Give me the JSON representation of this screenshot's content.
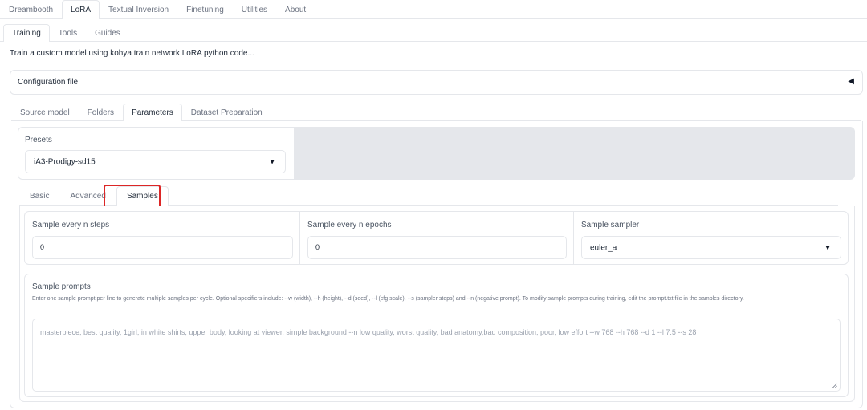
{
  "top_tabs": {
    "items": [
      {
        "label": "Dreambooth",
        "active": false
      },
      {
        "label": "LoRA",
        "active": true
      },
      {
        "label": "Textual Inversion",
        "active": false
      },
      {
        "label": "Finetuning",
        "active": false
      },
      {
        "label": "Utilities",
        "active": false
      },
      {
        "label": "About",
        "active": false
      }
    ]
  },
  "sub_tabs": {
    "items": [
      {
        "label": "Training",
        "active": true
      },
      {
        "label": "Tools",
        "active": false
      },
      {
        "label": "Guides",
        "active": false
      }
    ]
  },
  "description": "Train a custom model using kohya train network LoRA python code...",
  "config_accordion": {
    "label": "Configuration file",
    "arrow": "◀"
  },
  "param_tabs": {
    "items": [
      {
        "label": "Source model",
        "active": false
      },
      {
        "label": "Folders",
        "active": false
      },
      {
        "label": "Parameters",
        "active": true
      },
      {
        "label": "Dataset Preparation",
        "active": false
      }
    ]
  },
  "presets": {
    "label": "Presets",
    "value": "iA3-Prodigy-sd15",
    "caret": "▼"
  },
  "inner_tabs": {
    "items": [
      {
        "label": "Basic",
        "active": false
      },
      {
        "label": "Advanced",
        "active": false
      },
      {
        "label": "Samples",
        "active": true
      }
    ],
    "highlight_color": "#dc2626"
  },
  "samples": {
    "every_n_steps": {
      "label": "Sample every n steps",
      "value": "0"
    },
    "every_n_epochs": {
      "label": "Sample every n epochs",
      "value": "0"
    },
    "sampler": {
      "label": "Sample sampler",
      "value": "euler_a",
      "caret": "▼"
    },
    "prompts": {
      "label": "Sample prompts",
      "info": "Enter one sample prompt per line to generate multiple samples per cycle. Optional specifiers include: --w (width), --h (height), --d (seed), --l (cfg scale), --s (sampler steps) and --n (negative prompt). To modify sample prompts during training, edit the prompt.txt file in the samples directory.",
      "placeholder": "masterpiece, best quality, 1girl, in white shirts, upper body, looking at viewer, simple background --n low quality, worst quality, bad anatomy,bad composition, poor, low effort --w 768 --h 768 --d 1 --l 7.5 --s 28"
    }
  },
  "colors": {
    "border": "#e5e7eb",
    "panel_gray": "#e5e7eb",
    "text": "#1f2937",
    "muted": "#6b7280"
  }
}
